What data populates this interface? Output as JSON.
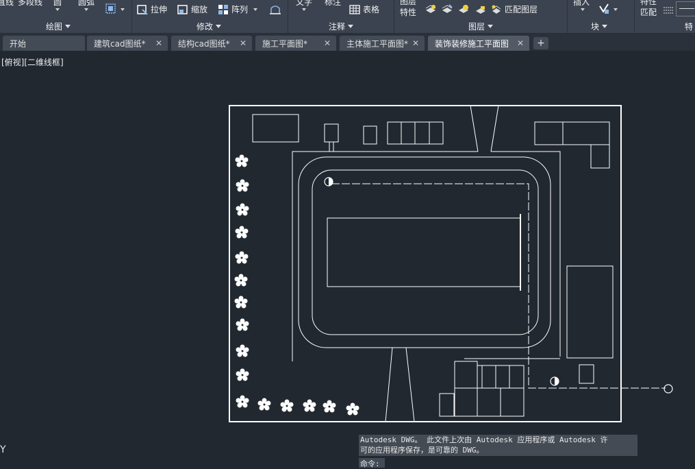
{
  "ribbon": {
    "draw": {
      "line_label": "直线",
      "polyline_label": "多段线",
      "circle_label": "圆",
      "arc_label": "圆弧",
      "panel_label": "绘图"
    },
    "modify": {
      "stretch_label": "拉伸",
      "scale_label": "缩放",
      "array_label": "阵列",
      "panel_label": "修改"
    },
    "annotation": {
      "text_label": "文字",
      "dimension_label": "标注",
      "table_label": "表格",
      "panel_label": "注释"
    },
    "layers": {
      "layer_props_label": "图层特性",
      "match_layer_label": "匹配图层",
      "panel_label": "图层"
    },
    "block": {
      "insert_label": "插入",
      "panel_label": "块"
    },
    "properties": {
      "match_props_label": "特性匹配",
      "panel_label": "特"
    }
  },
  "tabs": [
    {
      "label": "开始",
      "closable": false,
      "active": false
    },
    {
      "label": "建筑cad图纸*",
      "closable": true,
      "active": false
    },
    {
      "label": "结构cad图纸*",
      "closable": true,
      "active": false
    },
    {
      "label": "施工平面图*",
      "closable": true,
      "active": false
    },
    {
      "label": "主体施工平面图*",
      "closable": true,
      "active": false
    },
    {
      "label": "装饰装修施工平面图",
      "closable": true,
      "active": true
    }
  ],
  "viewport": {
    "label": "[俯视][二维线框]",
    "ucs_y": "Y"
  },
  "command": {
    "history_line1": "Autodesk DWG。  此文件上次由 Autodesk 应用程序或 Autodesk 许",
    "history_line2": "可的应用程序保存，是可靠的 DWG。",
    "prompt": "命令:"
  },
  "colors": {
    "background": "#212830",
    "ribbon": "#3b4350",
    "linework": "#ffffff"
  }
}
